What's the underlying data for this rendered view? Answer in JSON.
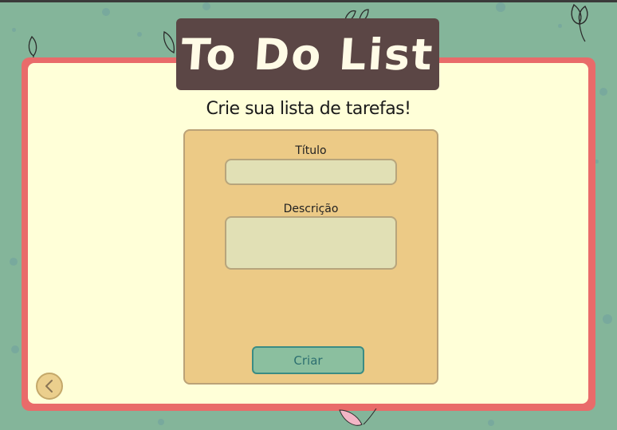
{
  "app": {
    "title": "To Do List",
    "subtitle": "Crie sua lista de tarefas!"
  },
  "form": {
    "title_label": "Título",
    "title_value": "",
    "title_placeholder": "",
    "description_label": "Descrição",
    "description_value": "",
    "description_placeholder": "",
    "submit_label": "Criar"
  },
  "navigation": {
    "back_icon": "chevron-left-icon"
  },
  "colors": {
    "background": "#84b59a",
    "frame": "#e96b6a",
    "card": "#ffffd8",
    "title_box": "#5b4645",
    "form_panel": "#ecca86",
    "input_fill": "#e1e0b5",
    "button_fill": "#8bbf9f",
    "button_text": "#2d6f70"
  }
}
